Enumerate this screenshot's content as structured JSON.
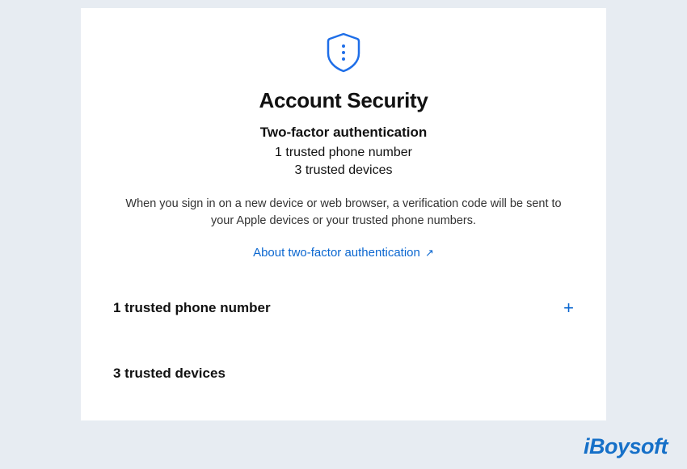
{
  "header": {
    "title": "Account Security",
    "subtitle": "Two-factor authentication",
    "phone_stat": "1 trusted phone number",
    "device_stat": "3 trusted devices",
    "description": "When you sign in on a new device or web browser, a verification code will be sent to your Apple devices or your trusted phone numbers.",
    "link_label": "About two-factor authentication",
    "link_arrow": "↗"
  },
  "sections": {
    "phone_heading": "1 trusted phone number",
    "devices_heading": "3 trusted devices",
    "add_symbol": "+"
  },
  "watermark": {
    "text": "iBoysoft"
  }
}
